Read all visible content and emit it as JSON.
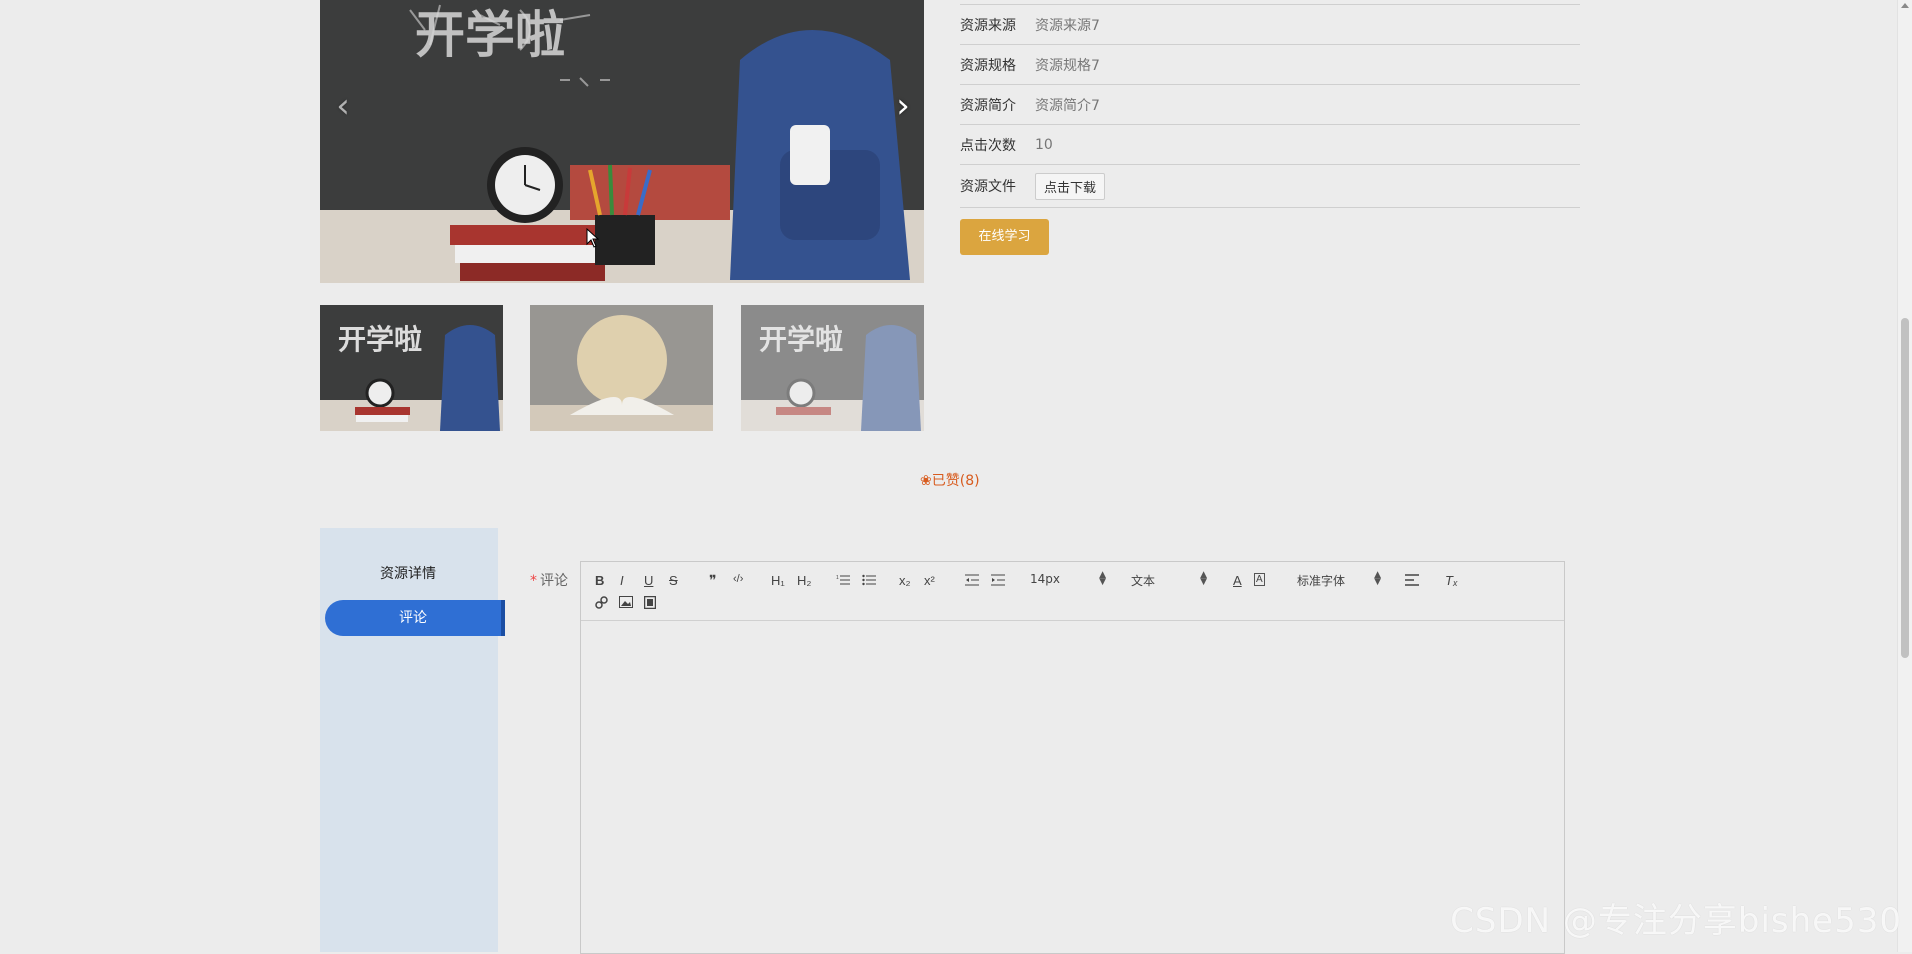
{
  "info": {
    "rows": [
      {
        "label": "资源来源",
        "value": "资源来源7"
      },
      {
        "label": "资源规格",
        "value": "资源规格7"
      },
      {
        "label": "资源简介",
        "value": "资源简介7"
      },
      {
        "label": "点击次数",
        "value": "10"
      }
    ],
    "file_label": "资源文件",
    "download_label": "点击下载",
    "study_label": "在线学习"
  },
  "carousel": {
    "prev_icon": "chevron-left-icon",
    "next_icon": "chevron-right-icon",
    "image_text": "开学啦"
  },
  "like": {
    "label": "已赞(8)",
    "icon": "thumbs-up-icon",
    "color": "#d85c1f"
  },
  "tabs": [
    {
      "label": "资源详情",
      "active": false
    },
    {
      "label": "评论",
      "active": true
    }
  ],
  "comment": {
    "required_mark": "*",
    "label": "评论",
    "font_size_value": "14px",
    "block_type_value": "文本",
    "font_family_value": "标准字体"
  },
  "toolbar_labels": {
    "bold": "B",
    "italic": "I",
    "underline": "U",
    "strike": "S",
    "quote": "❞",
    "code": "‹/›",
    "h1": "H₁",
    "h2": "H₂",
    "sub": "x₂",
    "sup": "x²",
    "color": "A",
    "clean": "Tₓ"
  },
  "watermark": "CSDN @专注分享bishe530",
  "colors": {
    "accent": "#2f6fd4",
    "study_button": "#dba53f",
    "like": "#d85c1f"
  }
}
